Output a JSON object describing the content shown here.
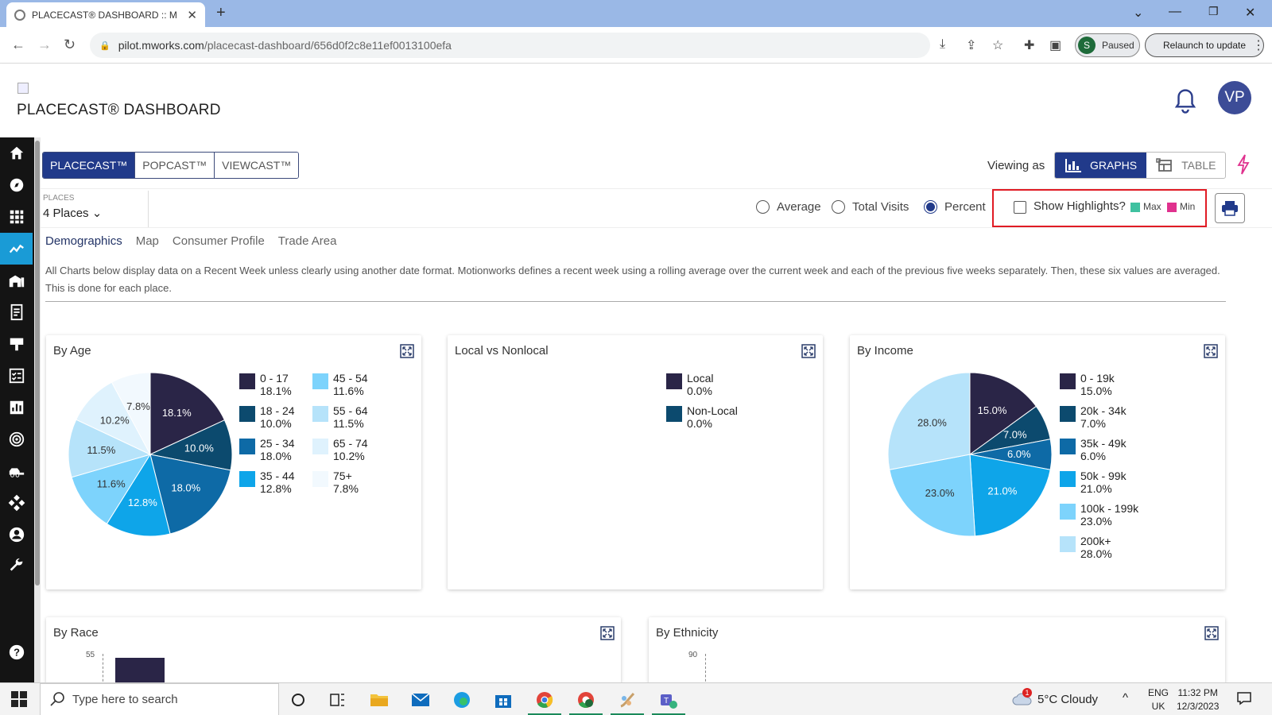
{
  "browser": {
    "tab_title": "PLACECAST® DASHBOARD :: M",
    "url_host": "pilot.mworks.com",
    "url_path": "/placecast-dashboard/656d0f2c8e11ef0013100efa",
    "profile_initial": "S",
    "profile_status": "Paused",
    "relaunch_label": "Relaunch to update"
  },
  "app": {
    "title": "PLACECAST® DASHBOARD",
    "avatar_initials": "VP"
  },
  "product_tabs": [
    {
      "label": "PLACECAST™",
      "active": true
    },
    {
      "label": "POPCAST™",
      "active": false
    },
    {
      "label": "VIEWCAST™",
      "active": false
    }
  ],
  "view": {
    "viewing_as": "Viewing as",
    "graphs_label": "GRAPHS",
    "table_label": "TABLE"
  },
  "controls": {
    "places_label": "PLACES",
    "places_value": "4 Places",
    "metric_options": [
      {
        "label": "Average",
        "selected": false
      },
      {
        "label": "Total Visits",
        "selected": false
      },
      {
        "label": "Percent",
        "selected": true
      }
    ],
    "show_highlights_label": "Show Highlights?",
    "show_highlights_checked": false,
    "max_label": "Max",
    "min_label": "Min",
    "max_color": "#3fc1a0",
    "min_color": "#e0318e"
  },
  "sub_tabs": [
    "Demographics",
    "Map",
    "Consumer Profile",
    "Trade Area"
  ],
  "notice": "All Charts below display data on a Recent Week unless clearly using another date format. Motionworks defines a recent week using a rolling average over the current week and each of the previous five weeks separately. Then, these six values are averaged. This is done for each place.",
  "colors": {
    "c1": "#2a2547",
    "c2": "#0c4a6e",
    "c3": "#0e6aa6",
    "c4": "#0ea5e9",
    "c5": "#7dd3fc",
    "c6": "#b6e3fa",
    "c7": "#dff2fd",
    "c8": "#f2f9fe"
  },
  "chart_data": [
    {
      "type": "pie",
      "title": "By Age",
      "categories": [
        "0 - 17",
        "18 - 24",
        "25 - 34",
        "35 - 44",
        "45 - 54",
        "55 - 64",
        "65 - 74",
        "75+"
      ],
      "values": [
        18.1,
        10.0,
        18.0,
        12.8,
        11.6,
        11.5,
        10.2,
        7.8
      ],
      "labels": [
        "18.1%",
        "10.0%",
        "18.0%",
        "12.8%",
        "11.6%",
        "11.5%",
        "10.2%",
        "7.8%"
      ]
    },
    {
      "type": "pie",
      "title": "Local vs Nonlocal",
      "categories": [
        "Local",
        "Non-Local"
      ],
      "values": [
        0.0,
        0.0
      ],
      "labels": [
        "0.0%",
        "0.0%"
      ]
    },
    {
      "type": "pie",
      "title": "By Income",
      "categories": [
        "0 - 19k",
        "20k - 34k",
        "35k - 49k",
        "50k - 99k",
        "100k - 199k",
        "200k+"
      ],
      "values": [
        15.0,
        7.0,
        6.0,
        21.0,
        23.0,
        28.0
      ],
      "labels": [
        "15.0%",
        "7.0%",
        "6.0%",
        "21.0%",
        "23.0%",
        "28.0%"
      ]
    },
    {
      "type": "bar",
      "title": "By Race",
      "y_ticks": [
        "55"
      ]
    },
    {
      "type": "bar",
      "title": "By Ethnicity",
      "y_ticks": [
        "90"
      ]
    }
  ],
  "taskbar": {
    "search_placeholder": "Type here to search",
    "weather": "5°C  Cloudy",
    "lang_line1": "ENG",
    "lang_line2": "UK",
    "time": "11:32 PM",
    "date": "12/3/2023",
    "weather_badge": "1"
  }
}
